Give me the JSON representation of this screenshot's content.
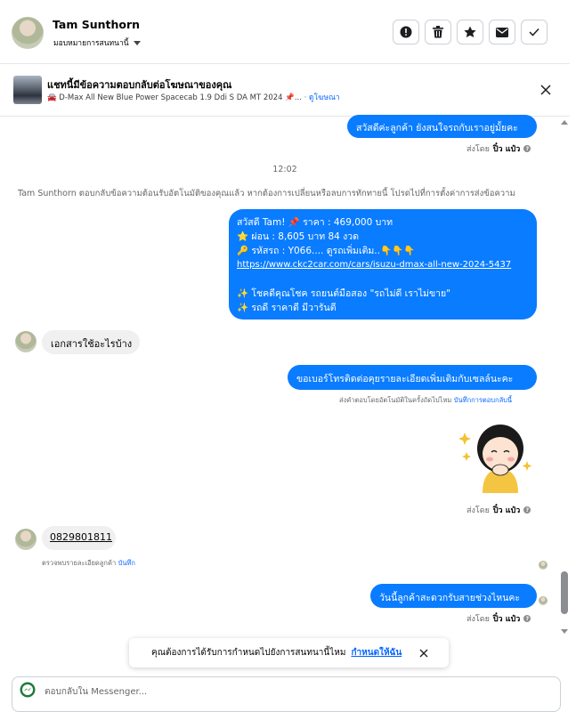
{
  "header": {
    "name": "Tam Sunthorn",
    "subtitle": "มอบหมายการสนทนานี้",
    "actions": [
      "report-icon",
      "trash-icon",
      "star-icon",
      "mail-icon",
      "check-icon"
    ]
  },
  "banner": {
    "title": "แชทนี้มีข้อความตอบกลับต่อโฆษณาของคุณ",
    "ad_text": "🚘 D-Max All New Blue Power Spacecab 1.9 Ddi S DA MT 2024 📌...",
    "ad_link": "ดูโฆษณา"
  },
  "messages": {
    "m1": "สวัสดีค่ะลูกค้า ยังสนใจรถกับเราอยู่มั้ยคะ",
    "m1_sent_by": "ส่งโดย",
    "m1_sender": "ปิ๋ว แป๋ว",
    "timestamp": "12:02",
    "system_note": "Tam Sunthorn ตอบกลับข้อความต้อนรับอัตโนมัติของคุณแล้ว หากต้องการเปลี่ยนหรือลบการทักทายนี้ โปรดไปที่การตั้งค่าการส่งข้อความ",
    "m2_lines": [
      "สวัสดี Tam! 📌 ราคา : 469,000 บาท",
      "⭐ ผ่อน : 8,605 บาท 84 งวด",
      "🔑 รหัสรถ : Y066.... ดูรถเพิ่มเติม..👇👇👇",
      "https://www.ckc2car.com/cars/isuzu-dmax-all-new-2024-5437",
      "",
      "✨ โชคดีคุณโชค รถยนต์มือสอง \"รถไม่ดี เราไม่ขาย\"",
      "✨ รถดี ราคาดี มีวารันตี"
    ],
    "in1": "เอกสารใช้อะไรบ้าง",
    "m3": "ขอเบอร์โทรติดต่อคุยรายละเอียดเพิ่มเติมกับเซลล์นะคะ",
    "m3_note": "ส่งคำตอบโดยอัตโนมัติในครั้งถัดไปไหม",
    "m3_note_link": "บันทึกการตอบกลับนี้",
    "sticker_sent_by": "ส่งโดย",
    "sticker_sender": "ปิ๋ว แป๋ว",
    "in2": "0829801811",
    "in2_note": "ตรวจพบรายละเอียดลูกค้า",
    "in2_note_link": "บันทึก",
    "m4": "วันนี้ลูกค้าสะดวกรับสายช่วงไหนคะ",
    "m4_sent_by": "ส่งโดย",
    "m4_sender": "ปิ๋ว แป๋ว"
  },
  "toast": {
    "text": "คุณต้องการได้รับการกำหนดไปยังการสนทนานี้ไหม",
    "link": "กำหนดให้ฉัน"
  },
  "composer": {
    "placeholder": "ตอบกลับใน Messenger..."
  },
  "colors": {
    "accent": "#0a7cff",
    "link": "#0866ff",
    "incoming_bg": "#f0f0f0"
  }
}
